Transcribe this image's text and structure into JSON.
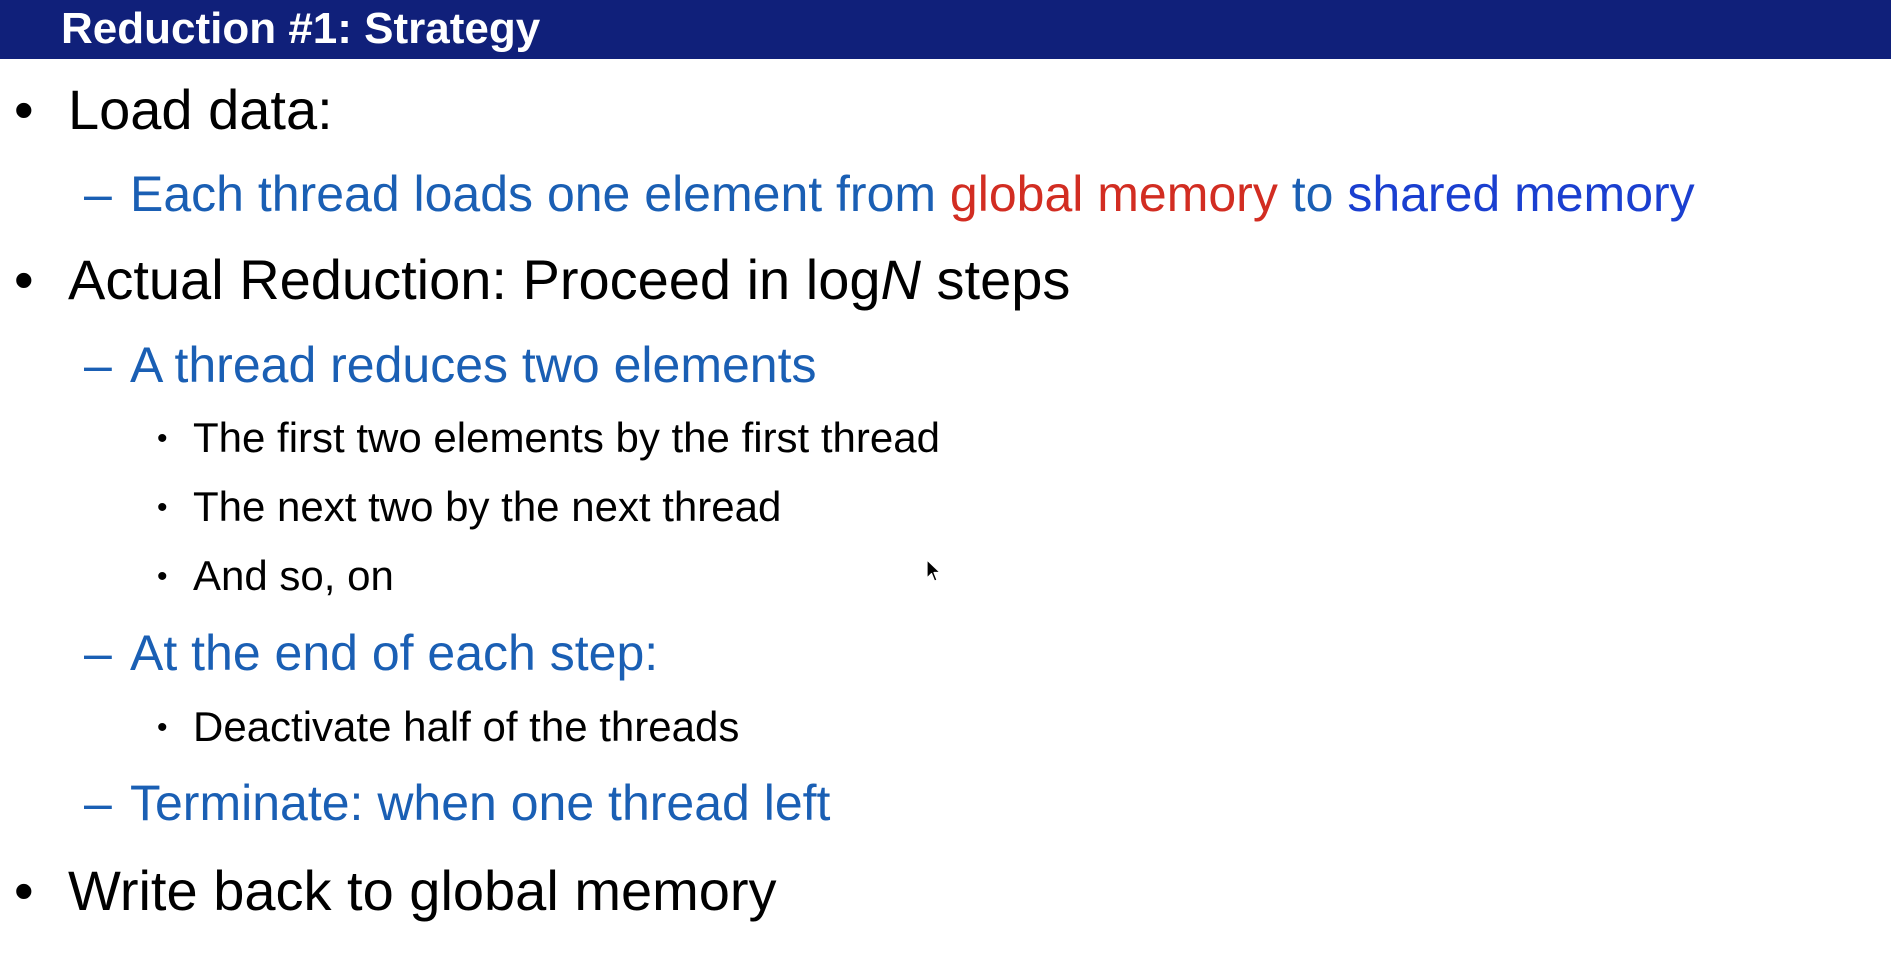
{
  "slide": {
    "title": "Reduction #1: Strategy",
    "items": {
      "load": {
        "bullet": "•",
        "label": "Load data:",
        "sub": {
          "dash": "–",
          "part1": "Each thread loads one element from ",
          "part2": "global memory",
          "part3": " to ",
          "part4": "shared memory"
        }
      },
      "reduction": {
        "bullet": "•",
        "label_pre": "Actual Reduction: Proceed in log",
        "label_var": "N",
        "label_post": " steps",
        "sub1": {
          "dash": "–",
          "label": "A thread reduces two elements",
          "points": [
            "The first two elements by the first thread",
            "The next two by the next thread",
            "And so, on"
          ]
        },
        "sub2": {
          "dash": "–",
          "label": "At the end of each step:",
          "points": [
            "Deactivate half of the threads"
          ]
        },
        "sub3": {
          "dash": "–",
          "label": "Terminate: when one thread left"
        }
      },
      "write": {
        "bullet": "•",
        "label": "Write back to global memory"
      }
    },
    "small_bullet": "•"
  },
  "colors": {
    "title_bar": "#10207a",
    "sub_text": "#1a5fb4",
    "highlight_red": "#d22d22",
    "highlight_blue": "#1a3fd0"
  },
  "icons": {
    "cursor": "mouse-pointer-icon"
  }
}
